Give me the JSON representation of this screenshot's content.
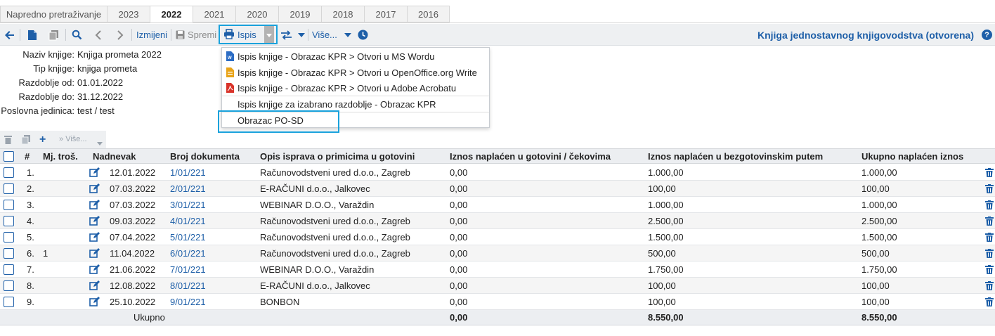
{
  "tabs": [
    "Napredno pretraživanje",
    "2023",
    "2022",
    "2021",
    "2020",
    "2019",
    "2018",
    "2017",
    "2016"
  ],
  "active_tab": "2022",
  "toolbar": {
    "edit_label": "Izmijeni",
    "save_label": "Spremi",
    "print_label": "Ispis",
    "more_label": "Više...",
    "page_title": "Knjiga jednostavnog knjigovodstva (otvorena)",
    "help": "?"
  },
  "info": {
    "naziv_label": "Naziv knjige:",
    "naziv": "Knjiga prometa 2022",
    "tip_label": "Tip knjige:",
    "tip": "knjiga prometa",
    "od_label": "Razdoblje od:",
    "od": "01.01.2022",
    "do_label": "Razdoblje do:",
    "do": "31.12.2022",
    "pj_label": "Poslovna jedinica:",
    "pj": "test / test"
  },
  "dropdown": [
    {
      "label": "Ispis knjige - Obrazac KPR > Otvori u MS Wordu",
      "icon": "word-icon"
    },
    {
      "label": "Ispis knjige - Obrazac KPR > Otvori u OpenOffice.org Write",
      "icon": "openoffice-icon"
    },
    {
      "label": "Ispis knjige - Obrazac KPR > Otvori u Adobe Acrobatu",
      "icon": "pdf-icon"
    },
    {
      "label": "Ispis knjige za izabrano razdoblje - Obrazac KPR",
      "icon": ""
    },
    {
      "label": "Obrazac PO-SD",
      "icon": ""
    }
  ],
  "grid_toolbar": {
    "more_label": "Više..."
  },
  "columns": [
    "#",
    "Mj. troš.",
    "Nadnevak",
    "Broj dokumenta",
    "Opis isprava o primicima u gotovini",
    "Iznos naplaćen u gotovini / čekovima",
    "Iznos naplaćen u bezgotovinskim putem",
    "Ukupno naplaćen iznos"
  ],
  "rows": [
    {
      "num": "1.",
      "mt": "",
      "date": "12.01.2022",
      "doc": "1/01/221",
      "desc": "Računovodstveni ured d.o.o., Zagreb",
      "cash": "0,00",
      "noncash": "1.000,00",
      "total": "1.000,00"
    },
    {
      "num": "2.",
      "mt": "",
      "date": "07.03.2022",
      "doc": "2/01/221",
      "desc": "E-RAČUNI d.o.o., Jalkovec",
      "cash": "0,00",
      "noncash": "100,00",
      "total": "100,00"
    },
    {
      "num": "3.",
      "mt": "",
      "date": "07.03.2022",
      "doc": "3/01/221",
      "desc": "WEBINAR D.O.O., Varaždin",
      "cash": "0,00",
      "noncash": "1.000,00",
      "total": "1.000,00"
    },
    {
      "num": "4.",
      "mt": "",
      "date": "09.03.2022",
      "doc": "4/01/221",
      "desc": "Računovodstveni ured d.o.o., Zagreb",
      "cash": "0,00",
      "noncash": "2.500,00",
      "total": "2.500,00"
    },
    {
      "num": "5.",
      "mt": "",
      "date": "07.04.2022",
      "doc": "5/01/221",
      "desc": "Računovodstveni ured d.o.o., Zagreb",
      "cash": "0,00",
      "noncash": "1.500,00",
      "total": "1.500,00"
    },
    {
      "num": "6.",
      "mt": "1",
      "date": "11.04.2022",
      "doc": "6/01/221",
      "desc": "Računovodstveni ured d.o.o., Zagreb",
      "cash": "0,00",
      "noncash": "500,00",
      "total": "500,00"
    },
    {
      "num": "7.",
      "mt": "",
      "date": "21.06.2022",
      "doc": "7/01/221",
      "desc": "WEBINAR D.O.O., Varaždin",
      "cash": "0,00",
      "noncash": "1.750,00",
      "total": "1.750,00"
    },
    {
      "num": "8.",
      "mt": "",
      "date": "12.08.2022",
      "doc": "8/01/221",
      "desc": "E-RAČUNI d.o.o., Jalkovec",
      "cash": "0,00",
      "noncash": "100,00",
      "total": "100,00"
    },
    {
      "num": "9.",
      "mt": "",
      "date": "25.10.2022",
      "doc": "9/01/221",
      "desc": "BONBON",
      "cash": "0,00",
      "noncash": "100,00",
      "total": "100,00"
    }
  ],
  "totals": {
    "label": "Ukupno",
    "cash": "0,00",
    "noncash": "8.550,00",
    "total": "8.550,00"
  },
  "colors": {
    "accent": "#1e5fa8",
    "highlight": "#1aa2dc"
  }
}
